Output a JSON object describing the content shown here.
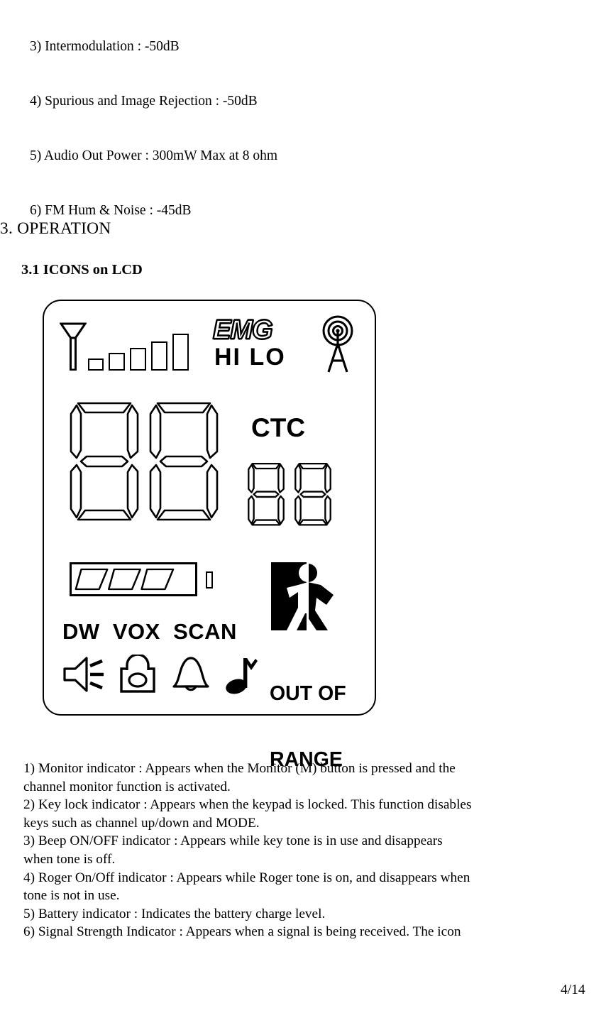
{
  "document": {
    "spec_lines": [
      "3) Intermodulation : -50dB",
      "4) Spurious and Image Rejection : -50dB",
      "5) Audio Out Power : 300mW Max at 8 ohm",
      "6) FM Hum & Noise : -45dB"
    ],
    "section_title": "3. OPERATION",
    "subsection_title": "3.1 ICONS on LCD",
    "body_lines": [
      "1) Monitor indicator : Appears when the Monitor (M) button is pressed and the",
      "channel monitor function is activated.",
      "2) Key lock indicator : Appears when the keypad is locked. This function disables",
      "keys such as channel up/down and MODE.",
      "3) Beep ON/OFF indicator : Appears while key tone is in use and disappears",
      "when tone is off.",
      "4) Roger On/Off indicator : Appears while Roger tone is on, and disappears when",
      "tone is not in use.",
      "5) Battery indicator : Indicates the battery charge level.",
      "6) Signal Strength Indicator : Appears when a signal is being received. The icon"
    ],
    "page_number": "4/14"
  },
  "lcd": {
    "emg_label": "EMG",
    "hilo_label": "HI LO",
    "ctc_label": "CTC",
    "mode_indicators": "DW  VOX  SCAN",
    "out_of_range_line1": "OUT OF",
    "out_of_range_line2": "RANGE",
    "main_digits": [
      "8",
      "8"
    ],
    "ctc_digits": [
      "8",
      "8"
    ],
    "signal_bar_count": 5,
    "battery_segment_count": 3,
    "icons": {
      "antenna": "antenna-icon",
      "tower": "transmit-tower-icon",
      "speaker": "speaker-icon",
      "lock": "key-lock-icon",
      "bell": "bell-icon",
      "note": "music-note-icon",
      "person": "out-of-range-person-icon",
      "battery": "battery-icon"
    },
    "colors": {
      "ink": "#000000",
      "panel": "#ffffff"
    }
  }
}
